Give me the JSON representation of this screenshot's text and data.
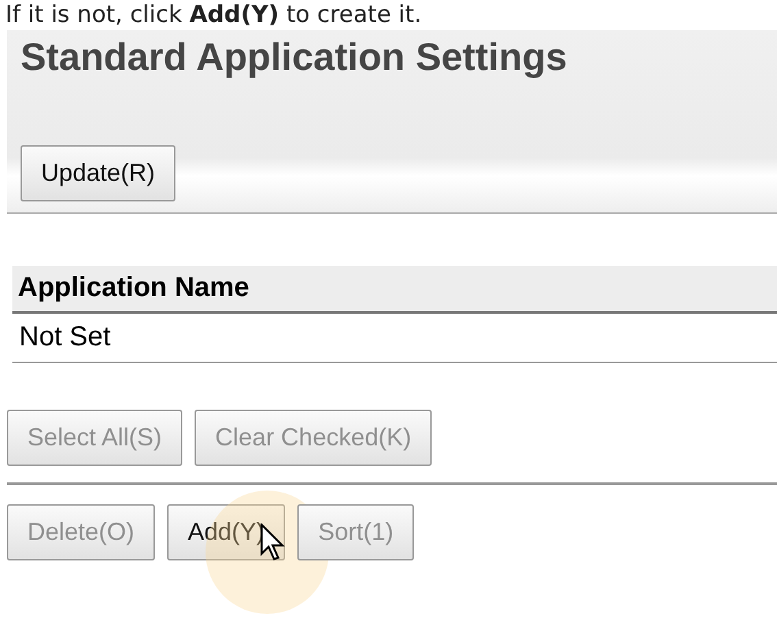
{
  "instruction": "If it is not, click **Add(Y)** to create it.",
  "panel": {
    "title": "Standard Application Settings",
    "update_button": {
      "label": "Update(R)",
      "disabled": false
    }
  },
  "table": {
    "columns": [
      "Application Name"
    ],
    "rows": [
      [
        "Not Set"
      ]
    ]
  },
  "selection_buttons": [
    {
      "label": "Select All(S)",
      "disabled": true
    },
    {
      "label": "Clear Checked(K)",
      "disabled": true
    }
  ],
  "action_buttons": [
    {
      "label": "Delete(O)",
      "disabled": true
    },
    {
      "label": "Add(Y)",
      "disabled": false,
      "hovered": true
    },
    {
      "label": "Sort(1)",
      "disabled": true
    }
  ]
}
